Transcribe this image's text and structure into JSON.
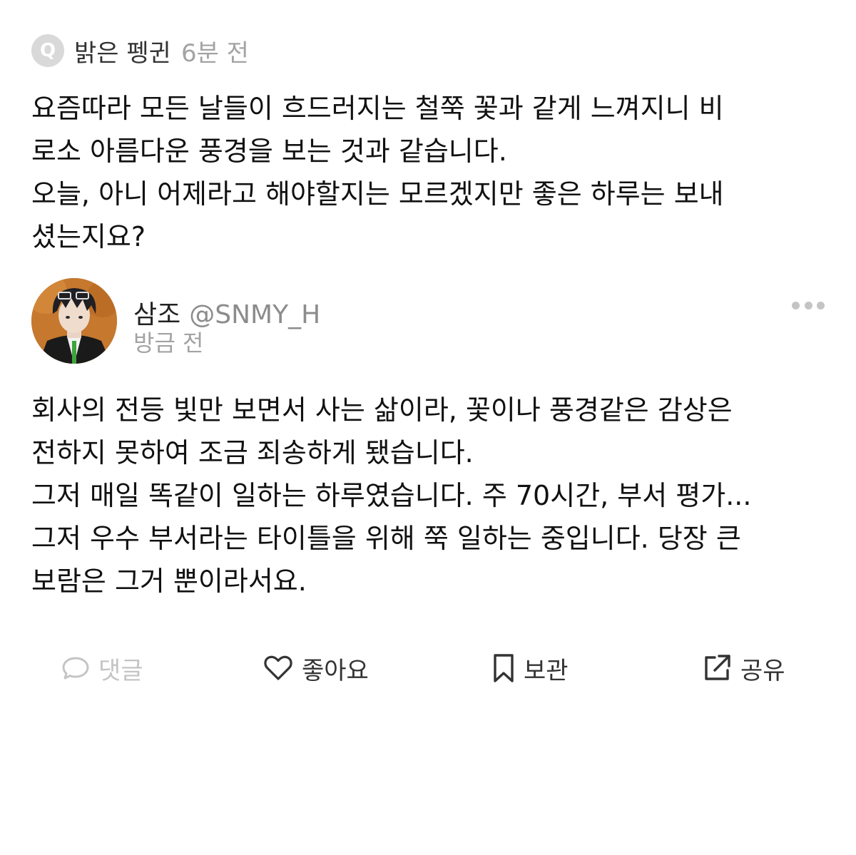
{
  "question": {
    "badge": "Q",
    "asker": "밝은 펭귄",
    "time": "6분 전",
    "lines": [
      "요즘따라 모든 날들이 흐드러지는 철쭉 꽃과 같게 느껴지니 비",
      "로소 아름다운 풍경을 보는 것과 같습니다.",
      "오늘, 아니 어제라고 해야할지는 모르겠지만 좋은 하루는 보내",
      "셨는지요?"
    ]
  },
  "answer": {
    "author": "삼조",
    "handle": "@SNMY_H",
    "time": "방금 전",
    "lines": [
      "회사의 전등 빛만 보면서 사는 삶이라, 꽃이나 풍경같은 감상은",
      "전하지 못하여 조금 죄송하게 됐습니다.",
      "그저 매일 똑같이 일하는 하루였습니다. 주 70시간, 부서 평가...",
      "그저 우수 부서라는 타이틀을 위해 쭉 일하는 중입니다. 당장 큰",
      "보람은 그거 뿐이라서요."
    ]
  },
  "actions": {
    "comment": "댓글",
    "like": "좋아요",
    "save": "보관",
    "share": "공유"
  },
  "icons": {
    "question_badge": "q-badge-icon",
    "more": "more-dots-icon",
    "comment": "speech-bubble-icon",
    "like": "heart-icon",
    "save": "bookmark-icon",
    "share": "share-arrow-icon"
  },
  "colors": {
    "text": "#111111",
    "muted": "#a3a3a3",
    "disabled": "#c4c4c4",
    "badge_bg": "#d9d9d9",
    "avatar_bg": "#c5782e"
  }
}
